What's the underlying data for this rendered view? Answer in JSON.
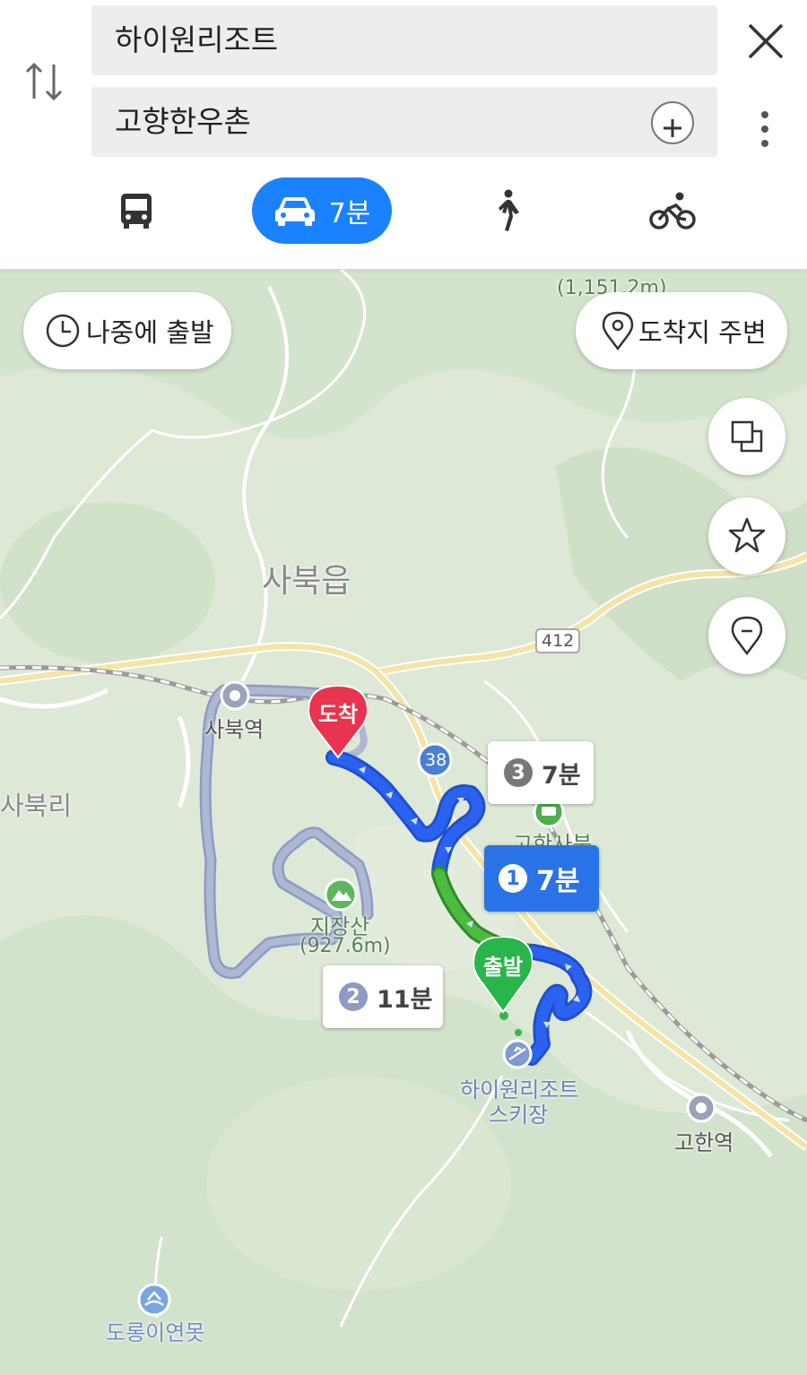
{
  "search": {
    "origin": "하이원리조트",
    "destination": "고향한우촌"
  },
  "modes": {
    "car_time": "7분"
  },
  "map_controls": {
    "depart_later": "나중에 출발",
    "near_destination": "도착지 주변"
  },
  "routes": [
    {
      "index": "1",
      "time": "7분"
    },
    {
      "index": "2",
      "time": "11분"
    },
    {
      "index": "3",
      "time": "7분"
    }
  ],
  "markers": {
    "arrival": "도착",
    "departure": "출발"
  },
  "map_labels": {
    "town": "사북읍",
    "village": "사북리",
    "station_sabuk": "사북역",
    "station_gohan": "고한역",
    "mountain_name": "지장산",
    "mountain_height": "(927.6m)",
    "peak_height": "(1,151.2m)",
    "resort_line1": "하이원리조트",
    "resort_line2": "스키장",
    "gohan_sabuk": "고한사북",
    "pond": "도롱이연못",
    "road_412": "412",
    "road_38": "38"
  },
  "colors": {
    "accent": "#1a82ff",
    "arrival_marker": "#e8344e",
    "departure_marker": "#28b54a",
    "route_main": "#1e5ce6",
    "route_green": "#45b33a",
    "route_alt": "#9aa4c4"
  }
}
